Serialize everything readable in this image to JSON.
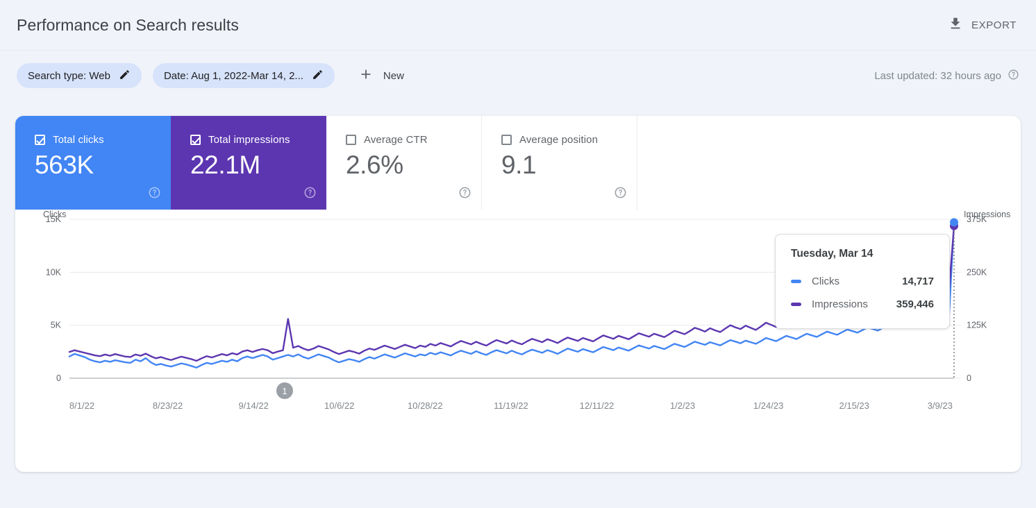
{
  "header": {
    "title": "Performance on Search results",
    "export_label": "EXPORT",
    "export_icon": "download-icon"
  },
  "filters": {
    "chips": [
      {
        "label": "Search type: Web",
        "edit_icon": "pencil-icon"
      },
      {
        "label": "Date: Aug 1, 2022-Mar 14, 2...",
        "edit_icon": "pencil-icon"
      }
    ],
    "new_label": "New",
    "new_icon": "plus-icon",
    "last_updated": "Last updated: 32 hours ago",
    "help_icon": "help-icon"
  },
  "metrics": [
    {
      "label": "Total clicks",
      "value": "563K",
      "checked": true,
      "color": "#4285f4"
    },
    {
      "label": "Total impressions",
      "value": "22.1M",
      "checked": true,
      "color": "#5c36b0"
    },
    {
      "label": "Average CTR",
      "value": "2.6%",
      "checked": false,
      "color": "#5f6368"
    },
    {
      "label": "Average position",
      "value": "9.1",
      "checked": false,
      "color": "#5f6368"
    }
  ],
  "tooltip": {
    "date": "Tuesday, Mar 14",
    "rows": [
      {
        "name": "Clicks",
        "value": "14,717",
        "color": "#4285f4"
      },
      {
        "name": "Impressions",
        "value": "359,446",
        "color": "#5c36b0"
      }
    ]
  },
  "annotation": {
    "label": "1"
  },
  "chart_data": {
    "type": "line",
    "title": "",
    "xlabel": "",
    "ylabel": "Clicks",
    "y2label": "Impressions",
    "ylim": [
      0,
      15000
    ],
    "y2lim": [
      0,
      375000
    ],
    "yticks": [
      0,
      5000,
      10000,
      15000
    ],
    "ytick_labels": [
      "0",
      "5K",
      "10K",
      "15K"
    ],
    "y2ticks": [
      0,
      125000,
      250000,
      375000
    ],
    "y2tick_labels": [
      "0",
      "125K",
      "250K",
      "375K"
    ],
    "grid": true,
    "legend": "none",
    "xtick_labels": [
      "8/1/22",
      "8/23/22",
      "9/14/22",
      "10/6/22",
      "10/28/22",
      "11/19/22",
      "12/11/22",
      "1/2/23",
      "1/24/23",
      "2/15/23",
      "3/9/23"
    ],
    "x_start": "8/1/22",
    "x_end": "3/14/23",
    "series": [
      {
        "name": "Clicks",
        "axis": "left",
        "color": "#4285f4",
        "values": [
          2050,
          2300,
          2150,
          2000,
          1750,
          1600,
          1500,
          1650,
          1550,
          1700,
          1600,
          1500,
          1450,
          1750,
          1600,
          1900,
          1500,
          1250,
          1350,
          1200,
          1100,
          1250,
          1400,
          1300,
          1150,
          1000,
          1250,
          1450,
          1350,
          1500,
          1650,
          1550,
          1750,
          1600,
          1900,
          2050,
          1900,
          2050,
          2200,
          2050,
          1750,
          1900,
          2050,
          2200,
          2050,
          2250,
          2000,
          1850,
          2050,
          2250,
          2100,
          1950,
          1700,
          1500,
          1650,
          1800,
          1700,
          1550,
          1800,
          2000,
          1850,
          2050,
          2250,
          2100,
          1950,
          2150,
          2350,
          2200,
          2050,
          2250,
          2150,
          2400,
          2250,
          2450,
          2300,
          2150,
          2400,
          2600,
          2450,
          2300,
          2550,
          2350,
          2200,
          2450,
          2650,
          2500,
          2350,
          2600,
          2400,
          2250,
          2500,
          2700,
          2550,
          2400,
          2650,
          2500,
          2300,
          2550,
          2800,
          2650,
          2500,
          2750,
          2600,
          2450,
          2700,
          2950,
          2800,
          2650,
          2900,
          2750,
          2600,
          2850,
          3100,
          2950,
          2800,
          3050,
          2900,
          2750,
          3000,
          3250,
          3100,
          2950,
          3200,
          3450,
          3300,
          3150,
          3400,
          3250,
          3100,
          3350,
          3600,
          3450,
          3300,
          3550,
          3400,
          3250,
          3500,
          3800,
          3650,
          3500,
          3750,
          4000,
          3850,
          3700,
          3950,
          4200,
          4050,
          3900,
          4150,
          4400,
          4250,
          4100,
          4350,
          4600,
          4450,
          4300,
          4550,
          4800,
          4650,
          4500,
          4750,
          5100,
          4900,
          4750,
          5000,
          5300,
          5150,
          5000,
          5250,
          5550,
          5400,
          5250,
          5500,
          5800,
          14717
        ]
      },
      {
        "name": "Impressions",
        "axis": "right",
        "color": "#5c36b0",
        "values": [
          62000,
          66000,
          63000,
          60000,
          57000,
          54000,
          52000,
          56000,
          53000,
          57000,
          54000,
          51000,
          50000,
          56000,
          53000,
          58000,
          52000,
          47000,
          50000,
          46000,
          43000,
          47000,
          51000,
          48000,
          45000,
          41000,
          47000,
          52000,
          49000,
          53000,
          57000,
          54000,
          59000,
          56000,
          63000,
          66000,
          62000,
          66000,
          69000,
          66000,
          59000,
          63000,
          66000,
          140000,
          72000,
          76000,
          70000,
          66000,
          70000,
          76000,
          72000,
          68000,
          62000,
          57000,
          61000,
          65000,
          62000,
          58000,
          65000,
          70000,
          67000,
          72000,
          77000,
          73000,
          69000,
          74000,
          79000,
          75000,
          71000,
          77000,
          74000,
          81000,
          77000,
          83000,
          79000,
          75000,
          82000,
          88000,
          84000,
          80000,
          86000,
          81000,
          77000,
          84000,
          90000,
          86000,
          82000,
          89000,
          84000,
          80000,
          87000,
          93000,
          89000,
          85000,
          92000,
          88000,
          83000,
          90000,
          96000,
          92000,
          88000,
          95000,
          91000,
          87000,
          94000,
          101000,
          97000,
          93000,
          100000,
          96000,
          92000,
          99000,
          106000,
          102000,
          98000,
          105000,
          101000,
          97000,
          104000,
          112000,
          108000,
          104000,
          111000,
          119000,
          115000,
          110000,
          118000,
          113000,
          109000,
          117000,
          125000,
          120000,
          116000,
          124000,
          119000,
          114000,
          122000,
          131000,
          126000,
          121000,
          130000,
          139000,
          134000,
          129000,
          138000,
          147000,
          142000,
          136000,
          145000,
          154000,
          149000,
          143000,
          152000,
          162000,
          156000,
          150000,
          160000,
          170000,
          164000,
          158000,
          168000,
          180000,
          173000,
          167000,
          177000,
          188000,
          181000,
          175000,
          186000,
          197000,
          190000,
          184000,
          195000,
          207000,
          359446
        ]
      }
    ]
  }
}
